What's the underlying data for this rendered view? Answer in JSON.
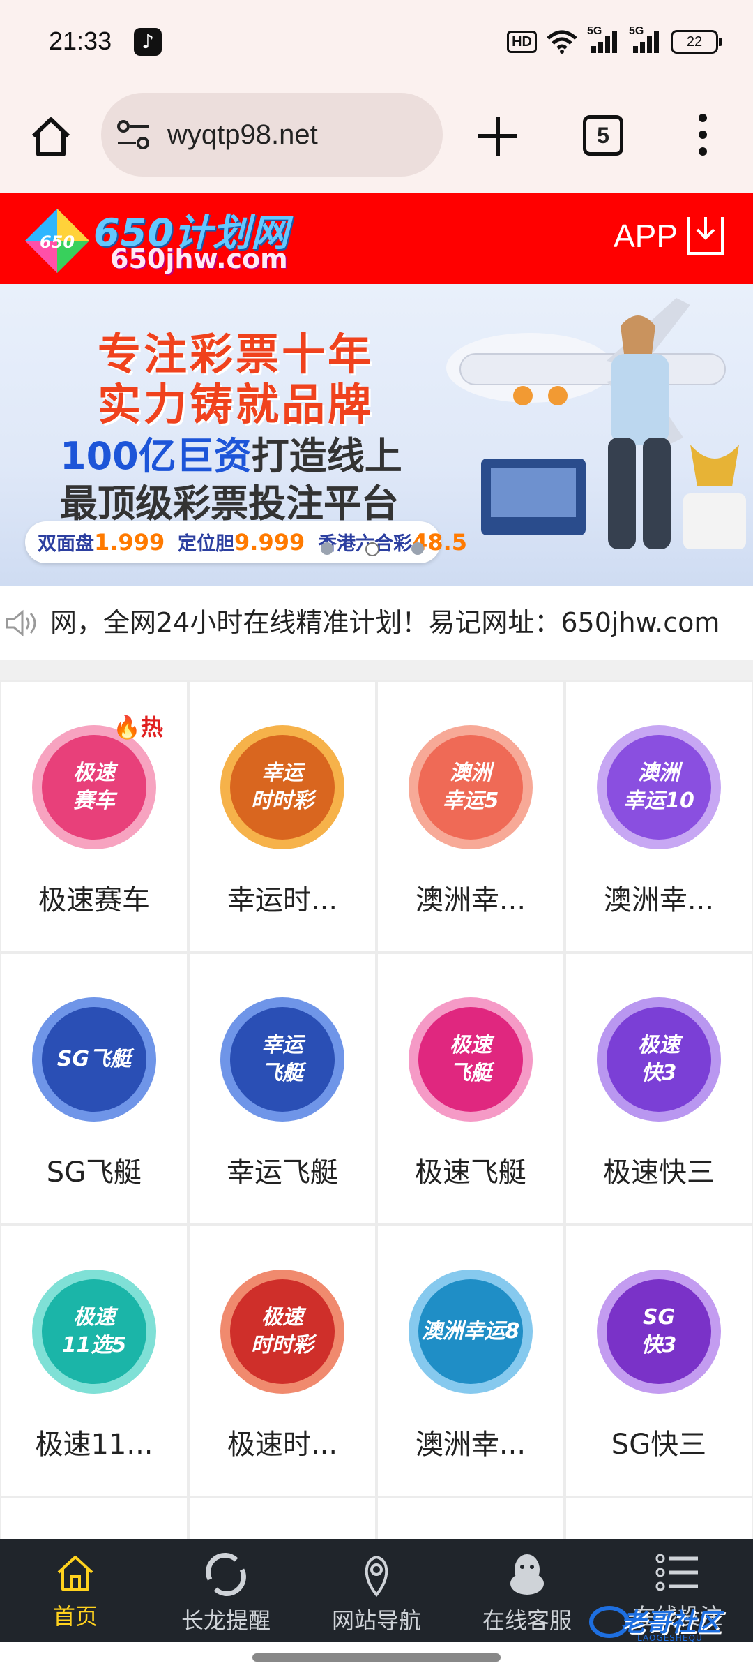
{
  "status_bar": {
    "time": "21:33",
    "hd_label": "HD",
    "network1": "5G",
    "network2": "5G",
    "battery": "22"
  },
  "browser": {
    "url": "wyqtp98.net",
    "tab_count": "5"
  },
  "site_header": {
    "logo_badge": "650",
    "logo_title": "650计划网",
    "logo_domain": "650jhw.com",
    "app_label": "APP"
  },
  "banner": {
    "line1": "专注彩票十年",
    "line2": "实力铸就品牌",
    "line3_highlight": "100亿巨资",
    "line3_rest": "打造线上",
    "line4": "最顶级彩票投注平台",
    "odds": [
      {
        "label": "双面盘",
        "value": "1.999"
      },
      {
        "label": "定位胆",
        "value": "9.999"
      },
      {
        "label": "香港六合彩",
        "value": "48.5"
      }
    ]
  },
  "marquee": {
    "text": "网，全网24小时在线精准计划！易记网址：650jhw.com"
  },
  "games": [
    {
      "label": "极速赛车",
      "chip": "极速\n赛车",
      "hot": "热",
      "color": "#e8407a",
      "ring": "#f7a3c0"
    },
    {
      "label": "幸运时...",
      "chip": "幸运\n时时彩",
      "color": "#d9661f",
      "ring": "#f6b24a"
    },
    {
      "label": "澳洲幸...",
      "chip": "澳洲\n幸运5",
      "color": "#ef6a56",
      "ring": "#f7a997"
    },
    {
      "label": "澳洲幸...",
      "chip": "澳洲\n幸运10",
      "color": "#8a4fe0",
      "ring": "#c7a7f3"
    },
    {
      "label": "SG飞艇",
      "chip": "SG飞艇",
      "color": "#2a4fb5",
      "ring": "#6f95e8"
    },
    {
      "label": "幸运飞艇",
      "chip": "幸运\n飞艇",
      "color": "#2a4fb5",
      "ring": "#6f95e8"
    },
    {
      "label": "极速飞艇",
      "chip": "极速\n飞艇",
      "color": "#e0277f",
      "ring": "#f59ac6"
    },
    {
      "label": "极速快三",
      "chip": "极速\n快3",
      "color": "#7b3fd6",
      "ring": "#b997f0"
    },
    {
      "label": "极速11...",
      "chip": "极速\n11选5",
      "color": "#1bb5a8",
      "ring": "#7fe0d6"
    },
    {
      "label": "极速时...",
      "chip": "极速\n时时彩",
      "color": "#cf2f2a",
      "ring": "#f08a6e"
    },
    {
      "label": "澳洲幸...",
      "chip": "澳洲幸运8",
      "color": "#1f8ec6",
      "ring": "#86c9ee"
    },
    {
      "label": "SG快三",
      "chip": "SG\n快3",
      "color": "#7a32c8",
      "ring": "#c39cf0"
    }
  ],
  "bottom_nav": [
    {
      "label": "首页",
      "icon": "home-icon",
      "active": true
    },
    {
      "label": "长龙提醒",
      "icon": "loop-icon"
    },
    {
      "label": "网站导航",
      "icon": "location-pin-icon"
    },
    {
      "label": "在线客服",
      "icon": "qq-penguin-icon"
    },
    {
      "label": "在线投注",
      "icon": "list-icon"
    }
  ],
  "watermark": {
    "text": "老哥社区",
    "sub": "LAOGESHEQU"
  },
  "colors": {
    "header_red": "#ff0000",
    "nav_bg": "#20252b",
    "nav_active": "#ffd21e",
    "browser_bg": "#fbf1ef"
  }
}
